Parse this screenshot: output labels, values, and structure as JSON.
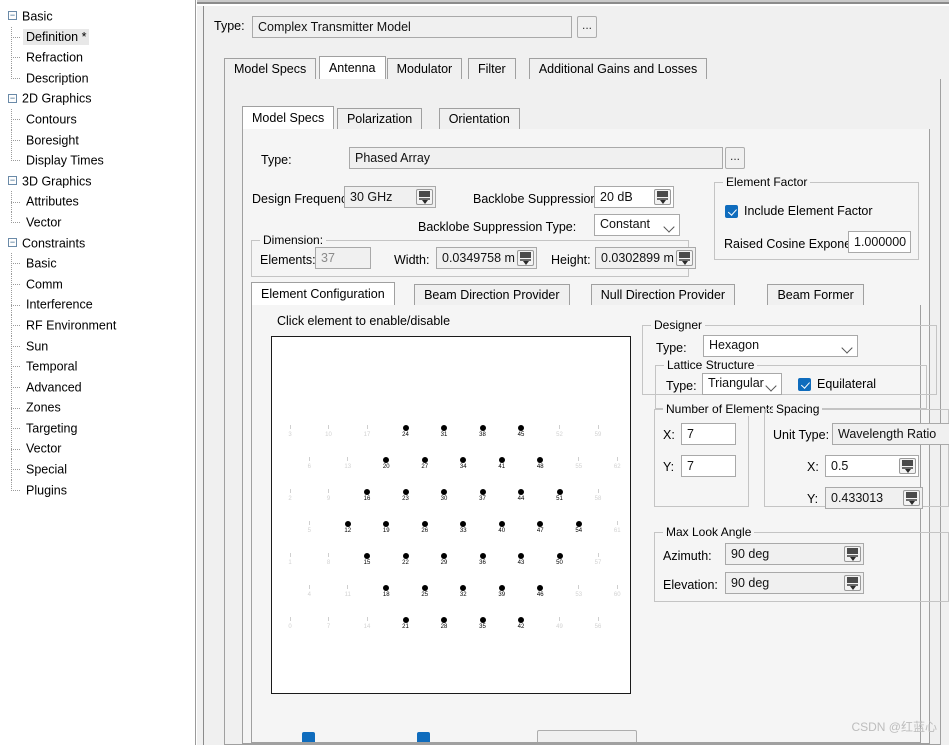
{
  "tree": {
    "items": [
      {
        "label": "Basic",
        "type": "group",
        "selected": false
      },
      {
        "label": "Definition *",
        "type": "child",
        "selected": true
      },
      {
        "label": "Refraction",
        "type": "child",
        "selected": false
      },
      {
        "label": "Description",
        "type": "child",
        "selected": false,
        "last": true
      },
      {
        "label": "2D Graphics",
        "type": "group",
        "selected": false
      },
      {
        "label": "Contours",
        "type": "child",
        "selected": false
      },
      {
        "label": "Boresight",
        "type": "child",
        "selected": false
      },
      {
        "label": "Display Times",
        "type": "child",
        "selected": false,
        "last": true
      },
      {
        "label": "3D Graphics",
        "type": "group",
        "selected": false
      },
      {
        "label": "Attributes",
        "type": "child",
        "selected": false
      },
      {
        "label": "Vector",
        "type": "child",
        "selected": false,
        "last": true
      },
      {
        "label": "Constraints",
        "type": "group",
        "selected": false
      },
      {
        "label": "Basic",
        "type": "child",
        "selected": false
      },
      {
        "label": "Comm",
        "type": "child",
        "selected": false
      },
      {
        "label": "Interference",
        "type": "child",
        "selected": false
      },
      {
        "label": "RF Environment",
        "type": "child",
        "selected": false
      },
      {
        "label": "Sun",
        "type": "child",
        "selected": false
      },
      {
        "label": "Temporal",
        "type": "child",
        "selected": false
      },
      {
        "label": "Advanced",
        "type": "child",
        "selected": false
      },
      {
        "label": "Zones",
        "type": "child",
        "selected": false
      },
      {
        "label": "Targeting",
        "type": "child",
        "selected": false
      },
      {
        "label": "Vector",
        "type": "child",
        "selected": false
      },
      {
        "label": "Special",
        "type": "child",
        "selected": false
      },
      {
        "label": "Plugins",
        "type": "child",
        "selected": false,
        "last": true
      }
    ],
    "expander_glyph": "−"
  },
  "model": {
    "type_label": "Type:",
    "type_value": "Complex Transmitter Model",
    "browse_label": "..."
  },
  "outer_tabs": [
    {
      "label": "Model Specs",
      "active": false
    },
    {
      "label": "Antenna",
      "active": true
    },
    {
      "label": "Modulator",
      "active": false
    },
    {
      "label": "Filter",
      "active": false
    },
    {
      "label": "Additional Gains and Losses",
      "active": false
    }
  ],
  "inner_tabs": [
    {
      "label": "Model Specs",
      "active": true
    },
    {
      "label": "Polarization",
      "active": false
    },
    {
      "label": "Orientation",
      "active": false
    }
  ],
  "antenna": {
    "type_label": "Type:",
    "type_value": "Phased Array",
    "browse_label": "...",
    "design_frequency_label": "Design Frequency:",
    "design_frequency_value": "30 GHz",
    "backlobe_suppression_label": "Backlobe Suppression:",
    "backlobe_suppression_value": "20 dB",
    "backlobe_suppression_type_label": "Backlobe Suppression Type:",
    "backlobe_suppression_type_value": "Constant"
  },
  "element_factor": {
    "group_title": "Element Factor",
    "include_label": "Include Element Factor",
    "include_checked": true,
    "raised_cosine_label": "Raised Cosine Exponent:",
    "raised_cosine_value": "1.000000"
  },
  "dimension": {
    "group_title": "Dimension:",
    "elements_label": "Elements:",
    "elements_value": "37",
    "width_label": "Width:",
    "width_value": "0.0349758 m",
    "height_label": "Height:",
    "height_value": "0.0302899 m"
  },
  "config_tabs": [
    {
      "label": "Element Configuration",
      "active": true
    },
    {
      "label": "Beam Direction Provider",
      "active": false
    },
    {
      "label": "Null Direction Provider",
      "active": false
    },
    {
      "label": "Beam Former",
      "active": false
    }
  ],
  "element_grid": {
    "hint": "Click element to enable/disable",
    "columns": 9,
    "rows": 7,
    "enabled_ids": [
      12,
      13,
      15,
      16,
      18,
      19,
      20,
      21,
      22,
      23,
      24,
      25,
      26,
      27,
      28,
      29,
      30,
      31,
      32,
      33,
      34,
      35,
      36,
      37,
      38,
      39,
      40,
      41,
      42,
      43,
      44,
      45,
      46,
      47,
      48,
      50,
      51,
      54
    ],
    "cells": [
      [
        {
          "id": 3,
          "on": false
        },
        {
          "id": 10,
          "on": false
        },
        {
          "id": 17,
          "on": false
        },
        {
          "id": 24,
          "on": true
        },
        {
          "id": 31,
          "on": true
        },
        {
          "id": 38,
          "on": true
        },
        {
          "id": 45,
          "on": true
        },
        {
          "id": 52,
          "on": false
        },
        {
          "id": 59,
          "on": false
        }
      ],
      [
        {
          "id": 6,
          "on": false
        },
        {
          "id": 13,
          "on": false
        },
        {
          "id": 20,
          "on": true
        },
        {
          "id": 27,
          "on": true
        },
        {
          "id": 34,
          "on": true
        },
        {
          "id": 41,
          "on": true
        },
        {
          "id": 48,
          "on": true
        },
        {
          "id": 55,
          "on": false
        },
        {
          "id": 62,
          "on": false
        }
      ],
      [
        {
          "id": 2,
          "on": false
        },
        {
          "id": 9,
          "on": false
        },
        {
          "id": 16,
          "on": true
        },
        {
          "id": 23,
          "on": true
        },
        {
          "id": 30,
          "on": true
        },
        {
          "id": 37,
          "on": true
        },
        {
          "id": 44,
          "on": true
        },
        {
          "id": 51,
          "on": true
        },
        {
          "id": 58,
          "on": false
        }
      ],
      [
        {
          "id": 5,
          "on": false
        },
        {
          "id": 12,
          "on": true
        },
        {
          "id": 19,
          "on": true
        },
        {
          "id": 26,
          "on": true
        },
        {
          "id": 33,
          "on": true
        },
        {
          "id": 40,
          "on": true
        },
        {
          "id": 47,
          "on": true
        },
        {
          "id": 54,
          "on": true
        },
        {
          "id": 61,
          "on": false
        }
      ],
      [
        {
          "id": 1,
          "on": false
        },
        {
          "id": 8,
          "on": false
        },
        {
          "id": 15,
          "on": true
        },
        {
          "id": 22,
          "on": true
        },
        {
          "id": 29,
          "on": true
        },
        {
          "id": 36,
          "on": true
        },
        {
          "id": 43,
          "on": true
        },
        {
          "id": 50,
          "on": true
        },
        {
          "id": 57,
          "on": false
        }
      ],
      [
        {
          "id": 4,
          "on": false
        },
        {
          "id": 11,
          "on": false
        },
        {
          "id": 18,
          "on": true
        },
        {
          "id": 25,
          "on": true
        },
        {
          "id": 32,
          "on": true
        },
        {
          "id": 39,
          "on": true
        },
        {
          "id": 46,
          "on": true
        },
        {
          "id": 53,
          "on": false
        },
        {
          "id": 60,
          "on": false
        }
      ],
      [
        {
          "id": 0,
          "on": false
        },
        {
          "id": 7,
          "on": false
        },
        {
          "id": 14,
          "on": false
        },
        {
          "id": 21,
          "on": true
        },
        {
          "id": 28,
          "on": true
        },
        {
          "id": 35,
          "on": true
        },
        {
          "id": 42,
          "on": true
        },
        {
          "id": 49,
          "on": false
        },
        {
          "id": 56,
          "on": false
        }
      ]
    ]
  },
  "designer": {
    "group_title": "Designer",
    "type_label": "Type:",
    "type_value": "Hexagon",
    "lattice": {
      "group_title": "Lattice Structure",
      "type_label": "Type:",
      "type_value": "Triangular",
      "equilateral_label": "Equilateral",
      "equilateral_checked": true
    },
    "number_of_elements": {
      "group_title": "Number of Elements",
      "x_label": "X:",
      "x_value": "7",
      "y_label": "Y:",
      "y_value": "7"
    },
    "spacing": {
      "group_title": "Spacing",
      "unit_type_label": "Unit Type:",
      "unit_type_value": "Wavelength Ratio",
      "x_label": "X:",
      "x_value": "0.5",
      "y_label": "Y:",
      "y_value": "0.433013"
    },
    "max_look_angle": {
      "group_title": "Max Look Angle",
      "azimuth_label": "Azimuth:",
      "azimuth_value": "90 deg",
      "elevation_label": "Elevation:",
      "elevation_value": "90 deg"
    }
  },
  "watermark": "CSDN @红蓝心",
  "colors": {
    "accent": "#0f6cbd",
    "panel": "#f0f0f0",
    "inner_panel": "#f5f5f5",
    "border": "#a0a0a0"
  }
}
